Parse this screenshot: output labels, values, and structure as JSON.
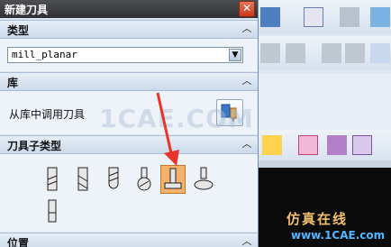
{
  "dialog": {
    "title": "新建刀具",
    "close_glyph": "✕",
    "sections": {
      "type": {
        "label": "类型",
        "value": "mill_planar"
      },
      "library": {
        "label": "库",
        "action_text": "从库中调用刀具"
      },
      "subtype": {
        "label": "刀具子类型",
        "selected_index": 4
      },
      "position": {
        "label": "位置"
      }
    }
  },
  "watermark": "1CAE.COM",
  "brand": {
    "name": "仿真在线",
    "url": "www.1CAE.com"
  },
  "colors": {
    "accent_selected": "#f5b26a",
    "arrow": "#e8342a"
  }
}
